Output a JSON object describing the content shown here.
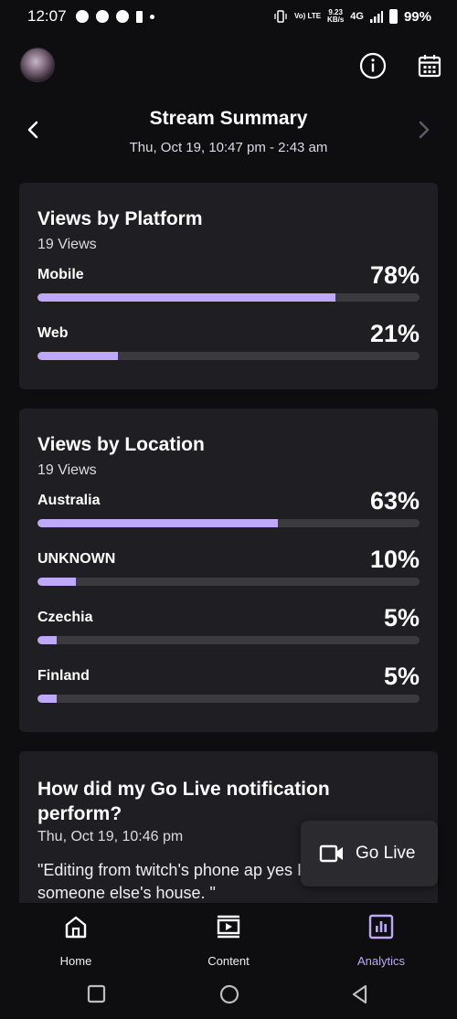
{
  "status_bar": {
    "time": "12:07",
    "volte": "Vo) LTE",
    "speed_value": "9.23",
    "speed_unit": "KB/s",
    "network": "4G",
    "battery": "99%"
  },
  "header": {
    "title": "Stream Summary",
    "date_range": "Thu, Oct 19, 10:47 pm - 2:43 am"
  },
  "platform_card": {
    "title": "Views by Platform",
    "views": "19 Views",
    "rows": [
      {
        "label": "Mobile",
        "pct_text": "78%",
        "value": 0.78
      },
      {
        "label": "Web",
        "pct_text": "21%",
        "value": 0.21
      }
    ]
  },
  "location_card": {
    "title": "Views by Location",
    "views": "19 Views",
    "rows": [
      {
        "label": "Australia",
        "pct_text": "63%",
        "value": 0.63
      },
      {
        "label": "UNKNOWN",
        "pct_text": "10%",
        "value": 0.1
      },
      {
        "label": "Czechia",
        "pct_text": "5%",
        "value": 0.05
      },
      {
        "label": "Finland",
        "pct_text": "5%",
        "value": 0.05
      }
    ]
  },
  "notification_card": {
    "title": "How did my Go Live notification perform?",
    "date": "Thu, Oct 19, 10:46 pm",
    "quote": "\"Editing from twitch's phone ap yes I'm still living at someone else's house. \""
  },
  "go_live": {
    "label": "Go Live"
  },
  "bottom_nav": {
    "home": "Home",
    "content": "Content",
    "analytics": "Analytics"
  },
  "colors": {
    "accent": "#bfa8f7",
    "card": "#1f1f23",
    "background": "#0e0e10",
    "track": "#3a3a3f"
  }
}
